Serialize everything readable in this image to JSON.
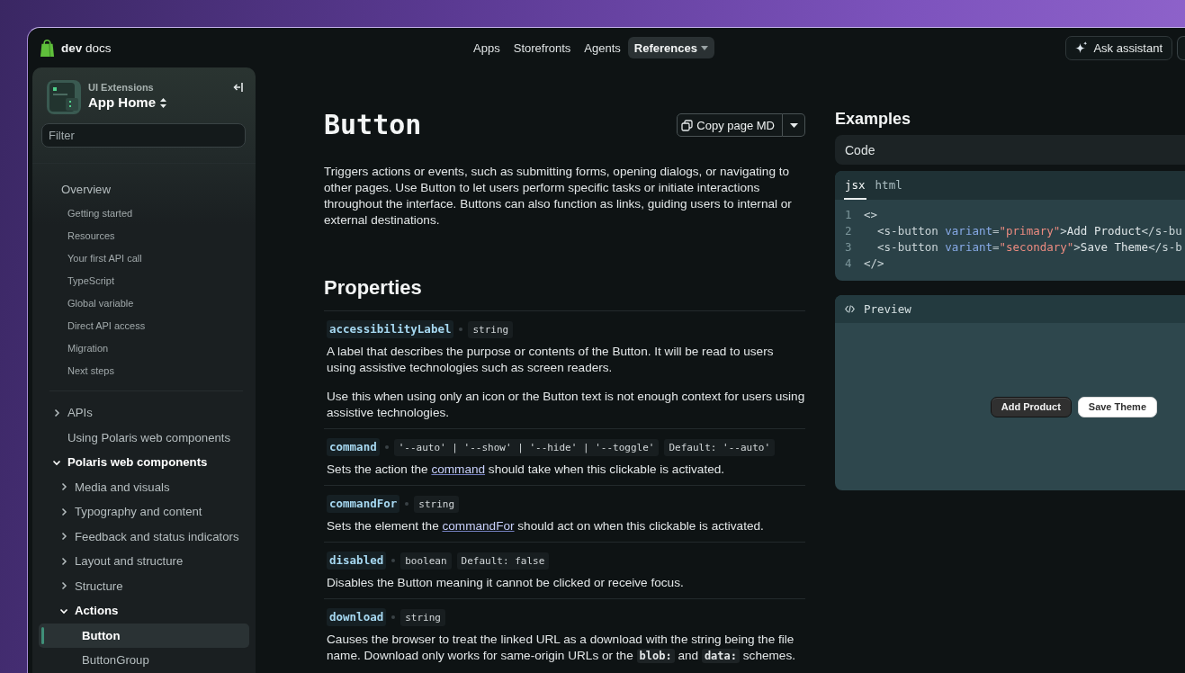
{
  "top_bar": {
    "logo": "**dev** docs",
    "nav": [
      {
        "label": "Apps",
        "kind": "link",
        "selected": false
      },
      {
        "label": "Storefronts",
        "kind": "link",
        "selected": false
      },
      {
        "label": "Agents",
        "kind": "link",
        "selected": false
      },
      {
        "label": "References",
        "kind": "menu",
        "selected": true
      }
    ],
    "assistant_button": {
      "label": "Ask assistant"
    }
  },
  "sidebar": {
    "header": {
      "subtitle": "UI Extensions",
      "title": "App Home"
    },
    "filter": {
      "placeholder": "Filter"
    },
    "sections": [
      {
        "items": [
          {
            "label": "Overview",
            "kind": "heading",
            "selected": false,
            "children": [
              {
                "label": "Getting started",
                "kind": "link",
                "selected": false
              },
              {
                "label": "Resources",
                "kind": "link",
                "selected": false
              },
              {
                "label": "Your first API call",
                "kind": "link",
                "selected": false
              },
              {
                "label": "TypeScript",
                "kind": "link",
                "selected": false
              },
              {
                "label": "Global variable",
                "kind": "link",
                "selected": false
              },
              {
                "label": "Direct API access",
                "kind": "link",
                "selected": false
              },
              {
                "label": "Migration",
                "kind": "link",
                "selected": false
              },
              {
                "label": "Next steps",
                "kind": "link",
                "selected": false
              }
            ]
          }
        ]
      },
      {
        "items": [
          {
            "label": "APIs",
            "kind": "group",
            "expanded": false,
            "selected": false
          },
          {
            "label": "Using Polaris web components",
            "kind": "link",
            "selected": false
          },
          {
            "label": "Polaris web components",
            "kind": "group",
            "expanded": true,
            "selected": false,
            "children": [
              {
                "label": "Media and visuals",
                "kind": "group",
                "expanded": false,
                "selected": false
              },
              {
                "label": "Typography and content",
                "kind": "group",
                "expanded": false,
                "selected": false
              },
              {
                "label": "Feedback and status indicators",
                "kind": "group",
                "expanded": false,
                "selected": false
              },
              {
                "label": "Layout and structure",
                "kind": "group",
                "expanded": false,
                "selected": false
              },
              {
                "label": "Structure",
                "kind": "group",
                "expanded": false,
                "selected": false
              },
              {
                "label": "Actions",
                "kind": "group",
                "expanded": true,
                "selected": false,
                "children": [
                  {
                    "label": "Button",
                    "kind": "link",
                    "selected": true
                  },
                  {
                    "label": "ButtonGroup",
                    "kind": "link",
                    "selected": false
                  }
                ]
              }
            ]
          }
        ]
      }
    ]
  },
  "page": {
    "title": "Button",
    "copy_button": {
      "label": "Copy page MD"
    },
    "description": "Triggers actions or events, such as submitting forms, opening dialogs, or navigating to other pages. Use Button to let users perform specific tasks or initiate interactions throughout the interface. Buttons can also function as links, guiding users to internal or external destinations.",
    "properties_heading": "Properties",
    "properties": [
      {
        "name": "accessibilityLabel",
        "type": "string",
        "paragraphs": [
          [
            {
              "kind": "text",
              "text": "A label that describes the purpose or contents of the Button. It will be read to users using assistive technologies such as screen readers."
            }
          ],
          [
            {
              "kind": "text",
              "text": "Use this when using only an icon or the Button text is not enough context for users using assistive technologies."
            }
          ]
        ]
      },
      {
        "name": "command",
        "type": "'--auto' | '--show' | '--hide' | '--toggle'",
        "default": "Default: '--auto'",
        "paragraphs": [
          [
            {
              "kind": "text",
              "text": "Sets the action the "
            },
            {
              "kind": "link",
              "text": "command"
            },
            {
              "kind": "text",
              "text": " should take when this clickable is activated."
            }
          ]
        ]
      },
      {
        "name": "commandFor",
        "type": "string",
        "paragraphs": [
          [
            {
              "kind": "text",
              "text": "Sets the element the "
            },
            {
              "kind": "link",
              "text": "commandFor"
            },
            {
              "kind": "text",
              "text": " should act on when this clickable is activated."
            }
          ]
        ]
      },
      {
        "name": "disabled",
        "type": "boolean",
        "default": "Default: false",
        "paragraphs": [
          [
            {
              "kind": "text",
              "text": "Disables the Button meaning it cannot be clicked or receive focus."
            }
          ]
        ]
      },
      {
        "name": "download",
        "type": "string",
        "paragraphs": [
          [
            {
              "kind": "text",
              "text": "Causes the browser to treat the linked URL as a download with the string being the file name. Download only works for same-origin URLs or the **blob:** and **data:** schemes."
            }
          ]
        ]
      }
    ]
  },
  "examples": {
    "heading": "Examples",
    "code_header": "Code",
    "code": {
      "tabs": [
        {
          "label": "jsx",
          "selected": true
        },
        {
          "label": "html",
          "selected": false
        }
      ],
      "lines": [
        {
          "number": "1",
          "tokens": [
            {
              "kind": "tag",
              "text": "<>"
            }
          ]
        },
        {
          "number": "2",
          "tokens": [
            {
              "kind": "tag",
              "text": "  <s-button "
            },
            {
              "kind": "attr",
              "text": "variant"
            },
            {
              "kind": "punct",
              "text": "="
            },
            {
              "kind": "string",
              "text": "\"primary\""
            },
            {
              "kind": "tag",
              "text": ">"
            },
            {
              "kind": "plain",
              "text": "Add Product"
            },
            {
              "kind": "tag",
              "text": "</s-bu"
            }
          ]
        },
        {
          "number": "3",
          "tokens": [
            {
              "kind": "tag",
              "text": "  <s-button "
            },
            {
              "kind": "attr",
              "text": "variant"
            },
            {
              "kind": "punct",
              "text": "="
            },
            {
              "kind": "string",
              "text": "\"secondary\""
            },
            {
              "kind": "tag",
              "text": ">"
            },
            {
              "kind": "plain",
              "text": "Save Theme"
            },
            {
              "kind": "tag",
              "text": "</s-b"
            }
          ]
        },
        {
          "number": "4",
          "tokens": [
            {
              "kind": "tag",
              "text": "</>"
            }
          ]
        }
      ]
    },
    "preview": {
      "title": "Preview",
      "buttons": [
        {
          "label": "Add Product",
          "kind": "primary"
        },
        {
          "label": "Save Theme",
          "kind": "secondary"
        }
      ]
    }
  }
}
